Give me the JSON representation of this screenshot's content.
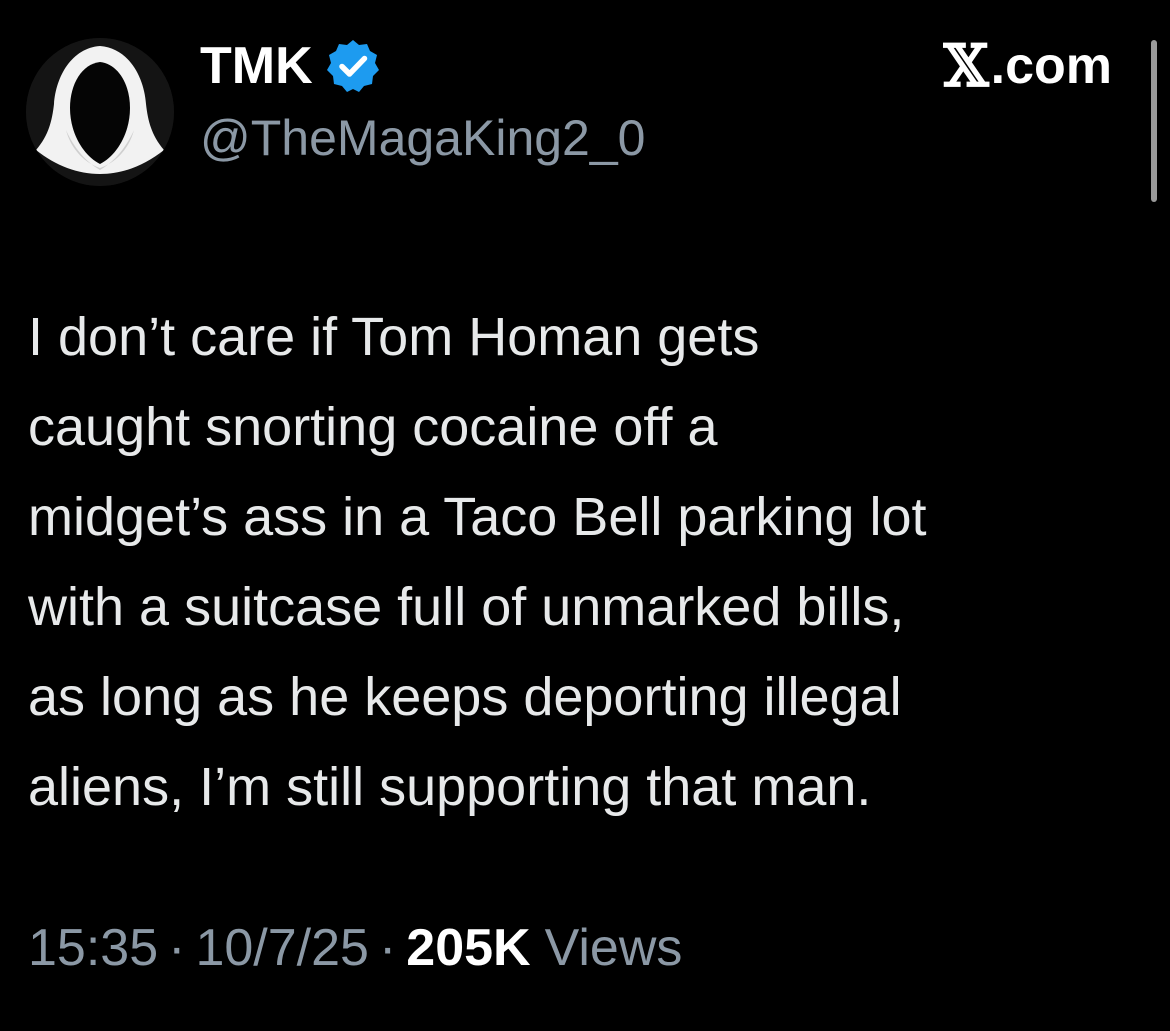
{
  "author": {
    "display_name": "TMK",
    "handle": "@TheMagaKing2_0",
    "verified": true,
    "avatar_icon": "hooded-figure-avatar"
  },
  "brand": {
    "x_glyph": "𝕏",
    "suffix": ".com"
  },
  "tweet": {
    "text": "I don’t care if Tom Homan gets\ncaught snorting cocaine off a\nmidget’s ass in a Taco Bell parking lot\nwith a suitcase full of unmarked bills,\nas long as he keeps deporting illegal\naliens, I’m still supporting that man."
  },
  "meta": {
    "time": "15:35",
    "separator": "·",
    "date": "10/7/25",
    "views_count": "205K",
    "views_label": "Views"
  },
  "colors": {
    "background": "#000000",
    "text_primary": "#e7e9ea",
    "text_secondary": "#8b98a5",
    "verified_badge": "#1d9bf0"
  }
}
